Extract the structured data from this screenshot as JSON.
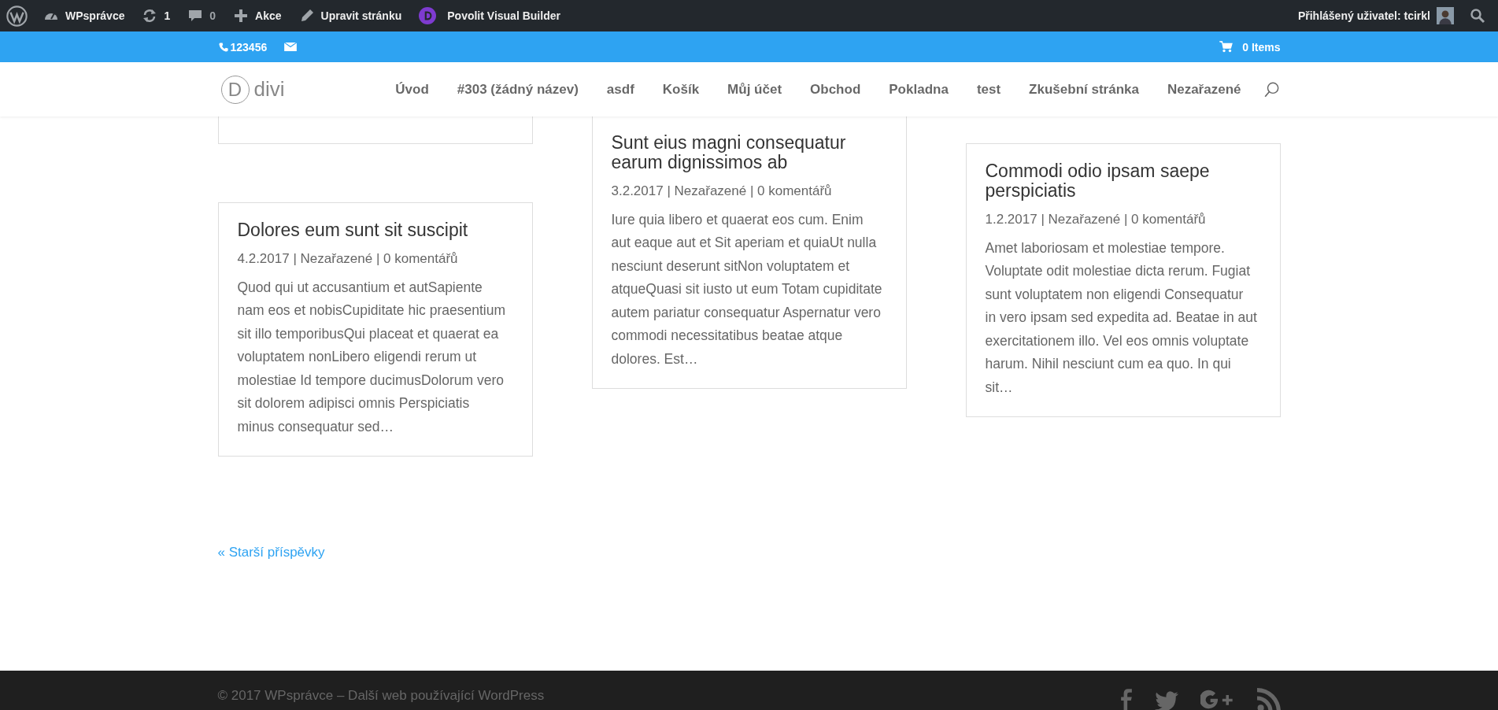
{
  "admin_bar": {
    "items": [
      {
        "kind": "wp-logo"
      },
      {
        "kind": "site",
        "label": "WPsprávce"
      },
      {
        "kind": "updates",
        "label": "1"
      },
      {
        "kind": "comments",
        "label": "0"
      },
      {
        "kind": "new",
        "label": "Akce"
      },
      {
        "kind": "edit",
        "label": "Upravit stránku"
      },
      {
        "kind": "divi",
        "label": "Povolit Visual Builder"
      }
    ],
    "account": {
      "label": "Přihlášený uživatel: tcirkl"
    }
  },
  "top_bar": {
    "phone": "123456",
    "cart": "0 Items"
  },
  "header": {
    "logo": {
      "letter": "D",
      "text": "divi"
    },
    "menu": [
      "Úvod",
      "#303 (žádný název)",
      "asdf",
      "Košík",
      "Můj účet",
      "Obchod",
      "Pokladna",
      "test",
      "Zkušební stránka",
      "Nezařazené"
    ]
  },
  "columns": [
    [
      {
        "kind": "cut"
      },
      {
        "kind": "post",
        "title": "Dolores eum sunt sit suscipit",
        "meta": "4.2.2017 | Nezařazené | 0 komentářů",
        "excerpt": "Quod qui ut accusantium et autSapiente nam eos et nobisCupiditate hic praesentium sit illo temporibusQui placeat et quaerat ea voluptatem nonLibero eligendi rerum ut molestiae Id tempore ducimusDolorum vero sit dolorem adipisci omnis Perspiciatis minus consequatur sed…"
      }
    ],
    [
      {
        "kind": "post",
        "title": "Sunt eius magni consequatur earum dignissimos ab",
        "meta": "3.2.2017 | Nezařazené | 0 komentářů",
        "excerpt": "Iure quia libero et quaerat eos cum. Enim aut eaque aut et Sit aperiam et quiaUt nulla nesciunt deserunt sitNon voluptatem et atqueQuasi sit iusto ut eum Totam cupiditate autem pariatur consequatur Aspernatur vero commodi necessitatibus beatae atque dolores. Est…"
      }
    ],
    [
      {
        "kind": "post",
        "title": "Commodi odio ipsam saepe perspiciatis",
        "meta": "1.2.2017 | Nezařazené | 0 komentářů",
        "excerpt": "Amet laboriosam et molestiae tempore. Voluptate odit molestiae dicta rerum. Fugiat sunt voluptatem non eligendi Consequatur in vero ipsam sed expedita ad. Beatae in aut exercitationem illo. Vel eos omnis voluptate harum. Nihil nesciunt cum ea quo. In qui sit…"
      }
    ]
  ],
  "pagination": {
    "older": "« Starší příspěvky"
  },
  "footer": {
    "credits": "© 2017 WPsprávce – Další web používající WordPress",
    "social": [
      {
        "kind": "facebook"
      },
      {
        "kind": "twitter"
      },
      {
        "kind": "google-plus"
      },
      {
        "kind": "rss"
      }
    ]
  }
}
